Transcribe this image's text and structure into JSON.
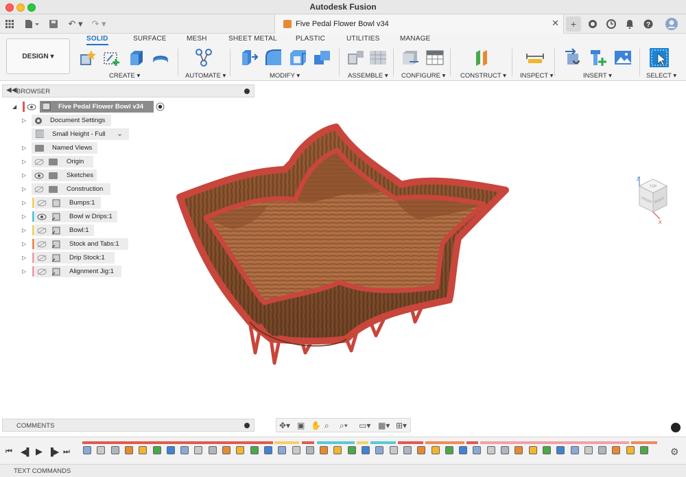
{
  "app_title": "Autodesk Fusion",
  "document_tab": {
    "title": "Five Pedal Flower Bowl v34",
    "icon": "document-cube-icon"
  },
  "workspace": {
    "label": "DESIGN ▾"
  },
  "category_tabs": [
    "SOLID",
    "SURFACE",
    "MESH",
    "SHEET METAL",
    "PLASTIC",
    "UTILITIES",
    "MANAGE"
  ],
  "active_category": "SOLID",
  "tool_groups": [
    "CREATE ▾",
    "AUTOMATE ▾",
    "MODIFY ▾",
    "ASSEMBLE ▾",
    "CONFIGURE ▾",
    "CONSTRUCT ▾",
    "INSPECT ▾",
    "INSERT ▾",
    "SELECT ▾"
  ],
  "browser": {
    "title": "BROWSER",
    "root": "Five Pedal Flower Bowl v34",
    "items": [
      {
        "label": "Document Settings",
        "icon": "gear-icon"
      },
      {
        "label": "Small Height - Full",
        "icon": "configuration-icon"
      },
      {
        "label": "Named Views",
        "icon": "folder-icon"
      },
      {
        "label": "Origin",
        "icon": "folder-icon"
      },
      {
        "label": "Sketches",
        "icon": "folder-icon"
      },
      {
        "label": "Construction",
        "icon": "folder-icon"
      },
      {
        "label": "Bumps:1",
        "icon": "component-icon",
        "color": "#f3d06b"
      },
      {
        "label": "Bowl w Drips:1",
        "icon": "component-icon",
        "color": "#5cc8d6"
      },
      {
        "label": "Bowl:1",
        "icon": "component-icon",
        "color": "#f3d06b"
      },
      {
        "label": "Stock and Tabs:1",
        "icon": "component-icon",
        "color": "#f08a5a"
      },
      {
        "label": "Drip Stock:1",
        "icon": "component-icon",
        "color": "#f2a0a8"
      },
      {
        "label": "Alignment Jig:1",
        "icon": "component-icon",
        "color": "#f2a0a8"
      }
    ]
  },
  "viewcube": {
    "top": "TOP",
    "front": "FRONT",
    "right": "RIGHT",
    "axis_z": "Z",
    "axis_x": "X"
  },
  "comments": {
    "title": "COMMENTS"
  },
  "text_commands": {
    "title": "TEXT COMMANDS"
  },
  "colors": {
    "accent": "#1a73c9",
    "bowl_rim": "#c8463c",
    "wood": "#9a5e38"
  }
}
